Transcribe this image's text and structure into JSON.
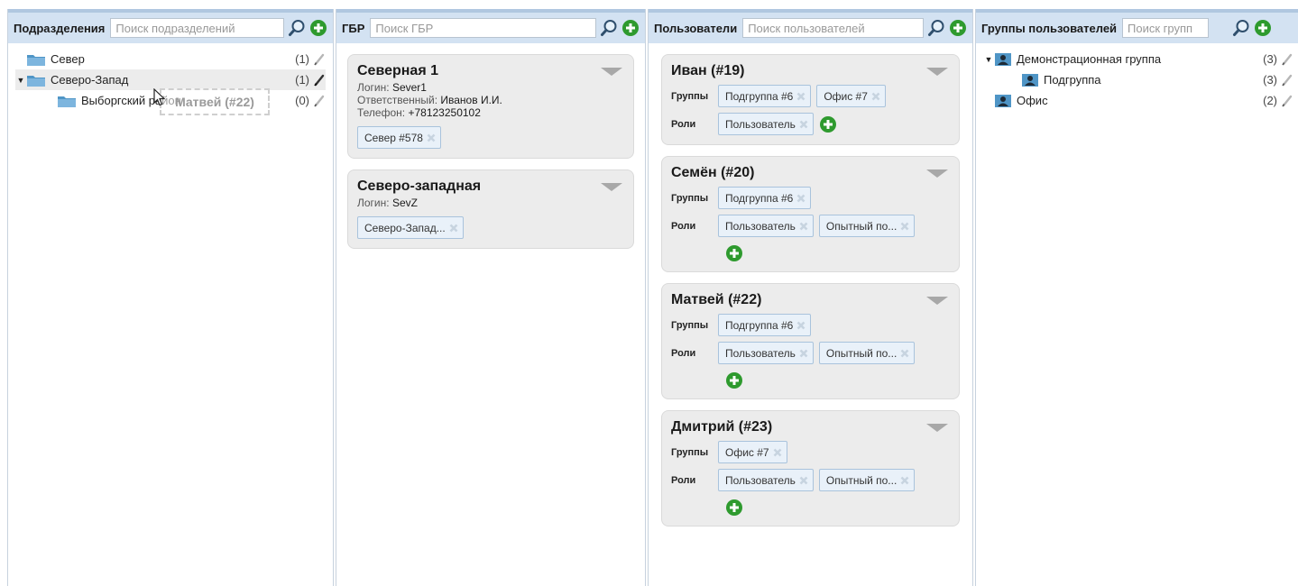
{
  "departments": {
    "title": "Подразделения",
    "search_placeholder": "Поиск подразделений",
    "items": [
      {
        "label": "Север",
        "count": "(1)"
      },
      {
        "label": "Северо-Запад",
        "count": "(1)"
      },
      {
        "label": "Выборгский район",
        "count": "(0)"
      }
    ]
  },
  "drag_ghost": "Матвей (#22)",
  "gbr": {
    "title": "ГБР",
    "search_placeholder": "Поиск ГБР",
    "cards": [
      {
        "title": "Северная 1",
        "login_label": "Логин:",
        "login": "Sever1",
        "resp_label": "Ответственный:",
        "resp": "Иванов И.И.",
        "phone_label": "Телефон:",
        "phone": "+78123250102",
        "tag": "Север #578"
      },
      {
        "title": "Северо-западная",
        "login_label": "Логин:",
        "login": "SevZ",
        "tag": "Северо-Запад..."
      }
    ]
  },
  "users": {
    "title": "Пользователи",
    "search_placeholder": "Поиск пользователей",
    "groups_label": "Группы",
    "roles_label": "Роли",
    "cards": [
      {
        "name": "Иван (#19)",
        "groups": [
          "Подгруппа #6",
          "Офис #7"
        ],
        "roles": [
          "Пользователь"
        ]
      },
      {
        "name": "Семён (#20)",
        "groups": [
          "Подгруппа #6"
        ],
        "roles": [
          "Пользователь",
          "Опытный по..."
        ]
      },
      {
        "name": "Матвей (#22)",
        "groups": [
          "Подгруппа #6"
        ],
        "roles": [
          "Пользователь",
          "Опытный по..."
        ]
      },
      {
        "name": "Дмитрий (#23)",
        "groups": [
          "Офис #7"
        ],
        "roles": [
          "Пользователь",
          "Опытный по..."
        ]
      }
    ]
  },
  "user_groups": {
    "title": "Группы пользователей",
    "search_placeholder": "Поиск групп",
    "items": [
      {
        "label": "Демонстрационная группа",
        "count": "(3)"
      },
      {
        "label": "Подгруппа",
        "count": "(3)"
      },
      {
        "label": "Офис",
        "count": "(2)"
      }
    ]
  },
  "colors": {
    "header_bg": "#d3e2f2",
    "card_bg": "#ececec",
    "tag_border": "#a9c3dc",
    "add_green": "#2e9a2e"
  }
}
